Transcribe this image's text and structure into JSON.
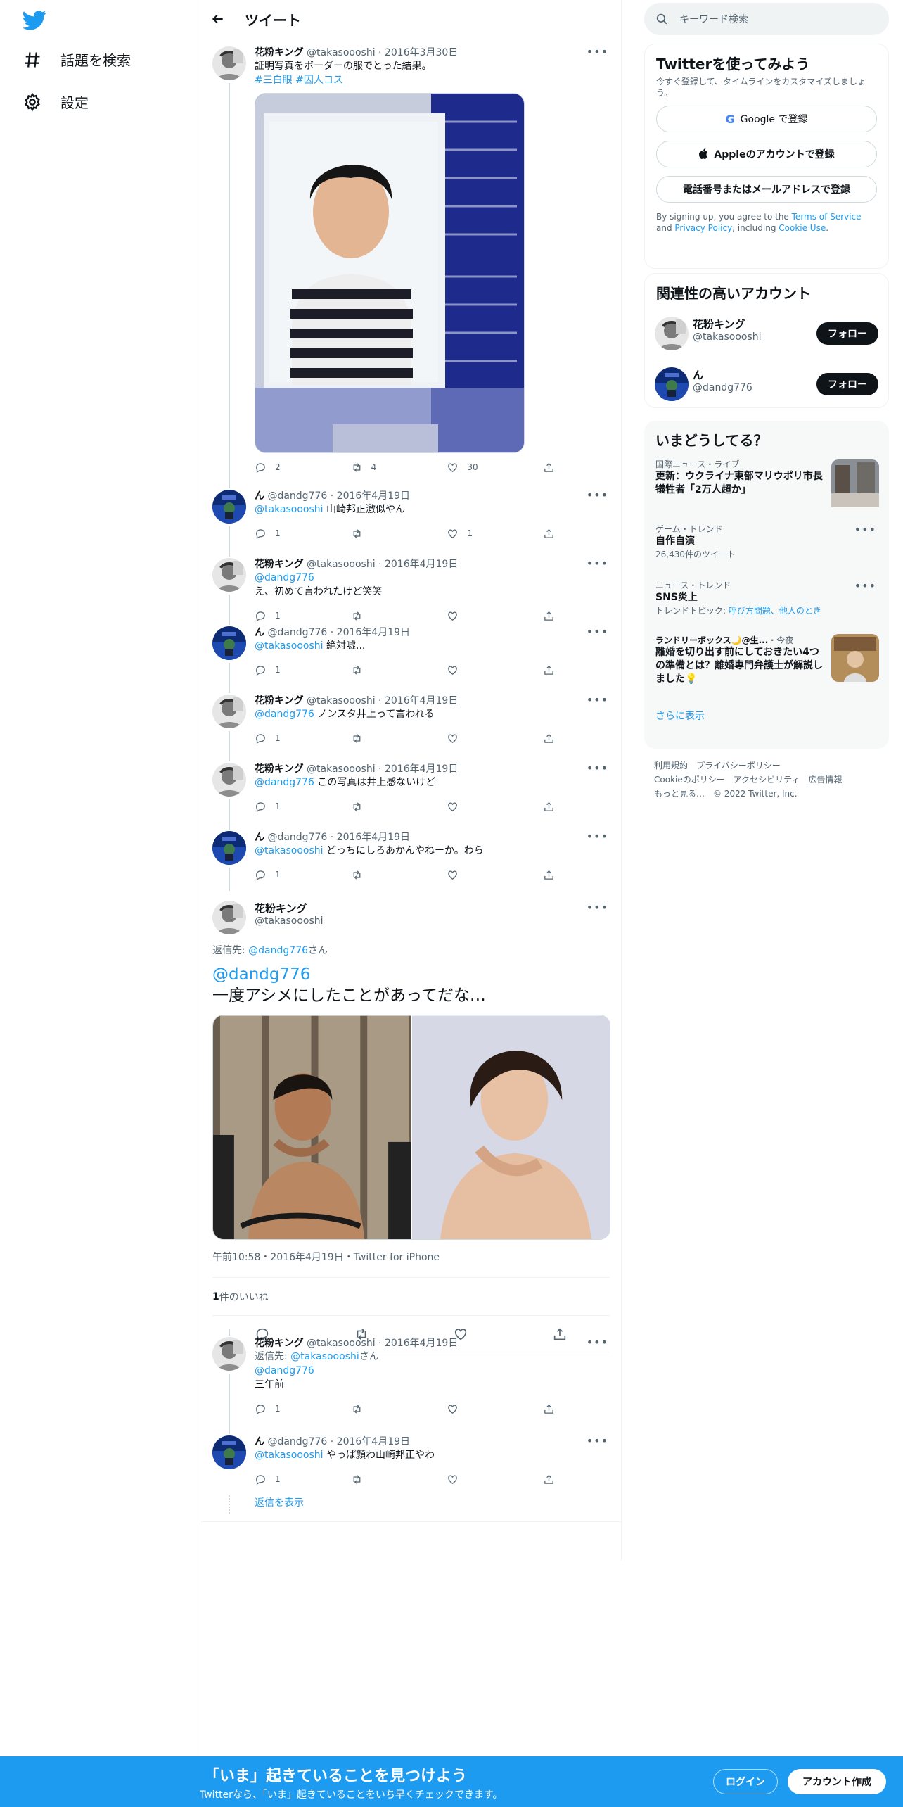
{
  "nav": {
    "explore": "話題を検索",
    "settings": "設定"
  },
  "header": {
    "title": "ツイート"
  },
  "tweets": [
    {
      "name": "花粉キング",
      "handle": "@takasoooshi",
      "date": "2016年3月30日",
      "text": "証明写真をボーダーの服でとった結果。",
      "tags": "#三白眼 #囚人コス",
      "reply": "2",
      "retweet": "4",
      "like": "30"
    },
    {
      "name": "ん",
      "handle": "@dandg776",
      "date": "2016年4月19日",
      "mention": "@takasoooshi",
      "text": "山崎邦正激似やん",
      "reply": "1",
      "like": "1"
    },
    {
      "name": "花粉キング",
      "handle": "@takasoooshi",
      "date": "2016年4月19日",
      "mention": "@dandg776",
      "text": "え、初めて言われたけど笑笑",
      "reply": "1"
    },
    {
      "name": "ん",
      "handle": "@dandg776",
      "date": "2016年4月19日",
      "mention": "@takasoooshi",
      "text": "絶対嘘...",
      "reply": "1"
    },
    {
      "name": "花粉キング",
      "handle": "@takasoooshi",
      "date": "2016年4月19日",
      "mention": "@dandg776",
      "text": "ノンスタ井上って言われる",
      "reply": "1"
    },
    {
      "name": "花粉キング",
      "handle": "@takasoooshi",
      "date": "2016年4月19日",
      "mention": "@dandg776",
      "text": "この写真は井上感ないけど",
      "reply": "1"
    },
    {
      "name": "ん",
      "handle": "@dandg776",
      "date": "2016年4月19日",
      "mention": "@takasoooshi",
      "text": "どっちにしろあかんやねーか。わら",
      "reply": "1"
    }
  ],
  "focus": {
    "name": "花粉キング",
    "handle": "@takasoooshi",
    "reply_prefix": "返信先: ",
    "reply_to": "@dandg776",
    "reply_suffix": "さん",
    "mention": "@dandg776",
    "text": "一度アシメにしたことがあってだな…",
    "timestamp": "午前10:58・2016年4月19日・Twitter for iPhone",
    "likes_count": "1",
    "likes_label": " 件のいいね"
  },
  "after": [
    {
      "name": "花粉キング",
      "handle": "@takasoooshi",
      "date": "2016年4月19日",
      "reply_prefix": "返信先: ",
      "reply_to": "@takasoooshi",
      "reply_suffix": "さん",
      "mention": "@dandg776",
      "text": "三年前",
      "reply": "1"
    },
    {
      "name": "ん",
      "handle": "@dandg776",
      "date": "2016年4月19日",
      "mention": "@takasoooshi",
      "text": "やっぱ顔わ山崎邦正やわ",
      "reply": "1"
    }
  ],
  "show_replies": "返信を表示",
  "search": {
    "placeholder": "キーワード検索"
  },
  "signup": {
    "title": "Twitterを使ってみよう",
    "desc": "今すぐ登録して、タイムラインをカスタマイズしましょう。",
    "google": "Google で登録",
    "apple": "Appleのアカウントで登録",
    "phone": "電話番号またはメールアドレスで登録",
    "terms_pre": "By signing up, you agree to the ",
    "terms": "Terms of Service",
    "terms_mid": " and ",
    "privacy": "Privacy Policy",
    "terms_mid2": ", including ",
    "cookie": "Cookie Use",
    "terms_end": "."
  },
  "related": {
    "title": "関連性の高いアカウント",
    "follow": "フォロー",
    "accounts": [
      {
        "name": "花粉キング",
        "handle": "@takasoooshi"
      },
      {
        "name": "ん",
        "handle": "@dandg776"
      }
    ]
  },
  "trends": {
    "title": "いまどうしてる？",
    "items": [
      {
        "meta": "国際ニュース・ライブ",
        "title": "更新：ウクライナ東部マリウポリ市長 犠牲者「2万人超か」"
      },
      {
        "meta": "ゲーム・トレンド",
        "title": "自作自演",
        "sub": "26,430件のツイート"
      },
      {
        "meta": "ニュース・トレンド",
        "title": "SNS炎上",
        "sub": "トレンドトピック: ",
        "sub_links": "呼び方問題、他人のとき"
      },
      {
        "meta_a": "ランドリーボックス🌙@生...",
        "meta_b": "・今夜",
        "title": "離婚を切り出す前にしておきたい4つの準備とは？離婚専門弁護士が解説しました💡"
      }
    ],
    "more": "さらに表示"
  },
  "footer": {
    "line1": "利用規約　プライバシーポリシー",
    "line2": "Cookieのポリシー　アクセシビリティ　広告情報",
    "line3": "もっと見る…　© 2022 Twitter, Inc."
  },
  "banner": {
    "title": "「いま」起きていることを見つけよう",
    "sub": "Twitterなら、「いま」起きていることをいち早くチェックできます。",
    "login": "ログイン",
    "signup": "アカウント作成"
  },
  "colors": {
    "accent": "#1d9bf0",
    "text": "#0f1419",
    "muted": "#536471"
  }
}
